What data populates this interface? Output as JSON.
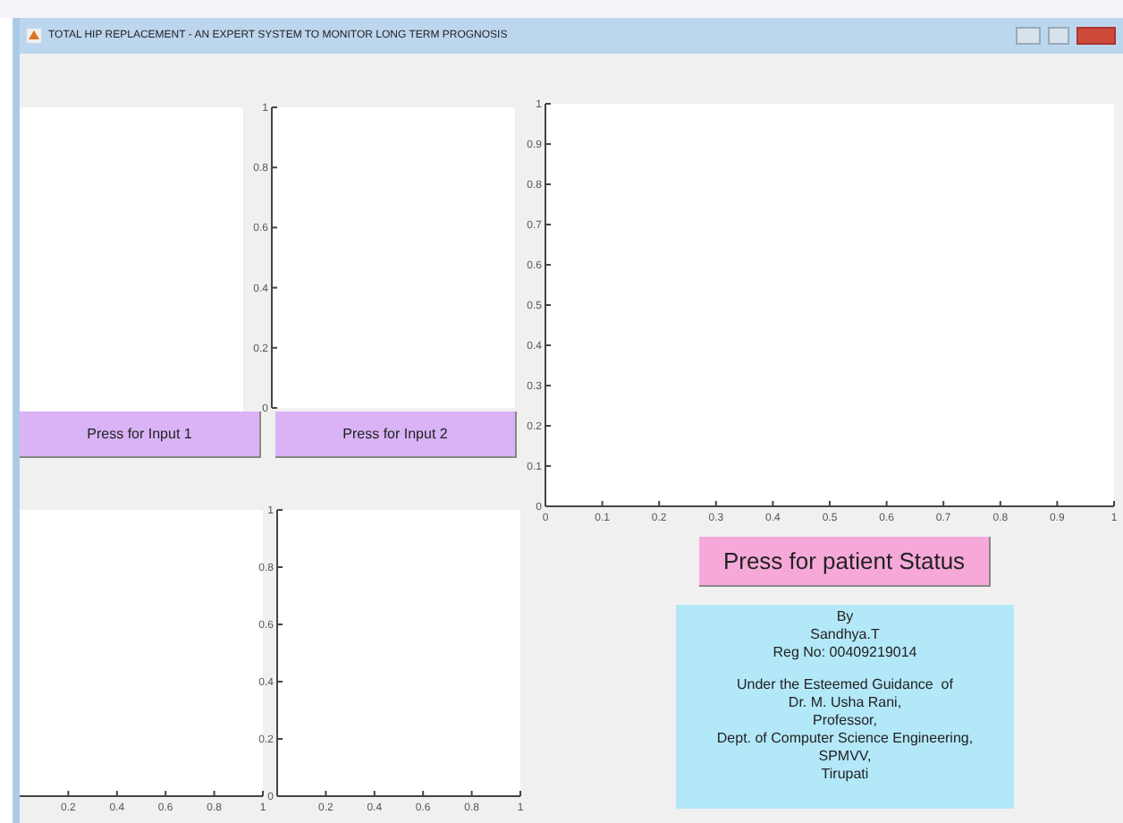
{
  "window": {
    "title": "TOTAL HIP REPLACEMENT - AN EXPERT SYSTEM TO MONITOR LONG TERM PROGNOSIS"
  },
  "plots": [
    {
      "chart_data": {
        "type": "line",
        "xlim": [
          0,
          1
        ],
        "ylim": [
          0,
          1
        ],
        "yticks": [
          0,
          0.2,
          0.4,
          0.6,
          0.8,
          1
        ]
      }
    },
    {
      "chart_data": {
        "type": "line",
        "xlim": [
          0,
          1
        ],
        "ylim": [
          0,
          1
        ],
        "xticks": [
          0.2,
          0.4,
          0.6,
          0.8,
          1
        ]
      }
    },
    {
      "chart_data": {
        "type": "line",
        "xlim": [
          0,
          1
        ],
        "ylim": [
          0,
          1
        ],
        "xticks": [
          0.2,
          0.4,
          0.6,
          0.8,
          1
        ],
        "yticks": [
          0,
          0.2,
          0.4,
          0.6,
          0.8,
          1
        ]
      }
    },
    {
      "chart_data": {
        "type": "line",
        "xlim": [
          0,
          1
        ],
        "ylim": [
          0,
          1
        ],
        "xticks": [
          0,
          0.1,
          0.2,
          0.3,
          0.4,
          0.5,
          0.6,
          0.7,
          0.8,
          0.9,
          1
        ],
        "yticks": [
          0,
          0.1,
          0.2,
          0.3,
          0.4,
          0.5,
          0.6,
          0.7,
          0.8,
          0.9,
          1
        ]
      }
    }
  ],
  "input_buttons": [
    "Press for Input 1",
    "Press for Input 2"
  ],
  "status_button": "Press for patient Status",
  "credits": [
    [
      "By",
      "Sandhya.T",
      "Reg No: 00409219014"
    ],
    [
      "Under the Esteemed Guidance  of",
      "Dr. M. Usha Rani,",
      "Professor,",
      "Dept. of Computer Science Engineering,",
      "SPMVV,",
      "Tirupati"
    ]
  ]
}
